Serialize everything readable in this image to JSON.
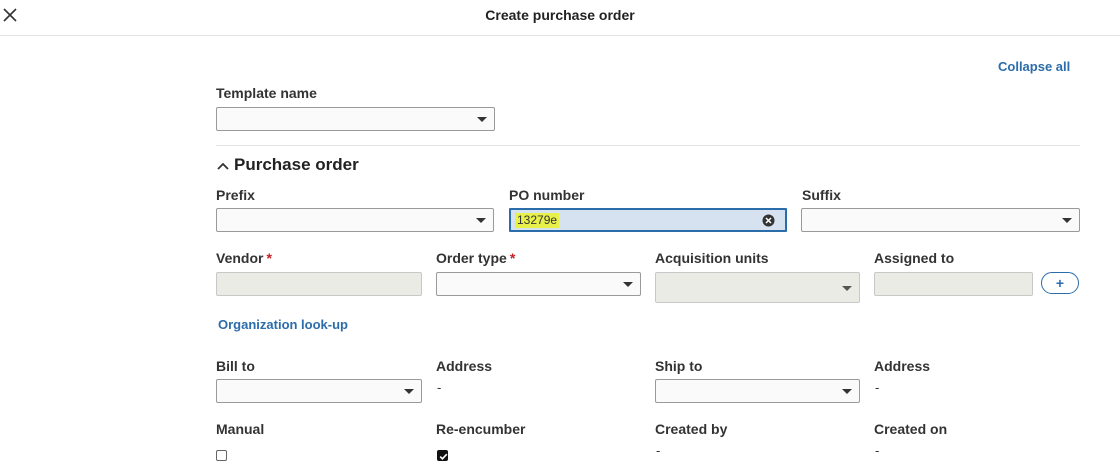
{
  "header": {
    "title": "Create purchase order"
  },
  "actions": {
    "collapse_all": "Collapse all"
  },
  "template": {
    "label": "Template name",
    "value": ""
  },
  "section": {
    "title": "Purchase order"
  },
  "fields": {
    "prefix": {
      "label": "Prefix",
      "value": ""
    },
    "po_number": {
      "label": "PO number",
      "value": "13279e"
    },
    "suffix": {
      "label": "Suffix",
      "value": ""
    },
    "vendor": {
      "label": "Vendor",
      "required_mark": "*",
      "value": ""
    },
    "order_type": {
      "label": "Order type",
      "required_mark": "*",
      "value": ""
    },
    "acquisition_units": {
      "label": "Acquisition units",
      "value": ""
    },
    "assigned_to": {
      "label": "Assigned to",
      "value": "",
      "add_label": "+"
    },
    "organization_lookup": "Organization look-up",
    "bill_to": {
      "label": "Bill to",
      "value": ""
    },
    "bill_address": {
      "label": "Address",
      "value": "-"
    },
    "ship_to": {
      "label": "Ship to",
      "value": ""
    },
    "ship_address": {
      "label": "Address",
      "value": "-"
    },
    "manual": {
      "label": "Manual",
      "checked": false
    },
    "re_encumber": {
      "label": "Re-encumber",
      "checked": true
    },
    "created_by": {
      "label": "Created by",
      "value": "-"
    },
    "created_on": {
      "label": "Created on",
      "value": "-"
    }
  },
  "colors": {
    "accent": "#2b6caa",
    "required": "#c71c22",
    "highlight": "#e8f04a"
  },
  "icons": [
    "close-icon",
    "chevron-up-icon",
    "caret-down-icon",
    "clear-circle-icon",
    "checkmark-icon"
  ]
}
